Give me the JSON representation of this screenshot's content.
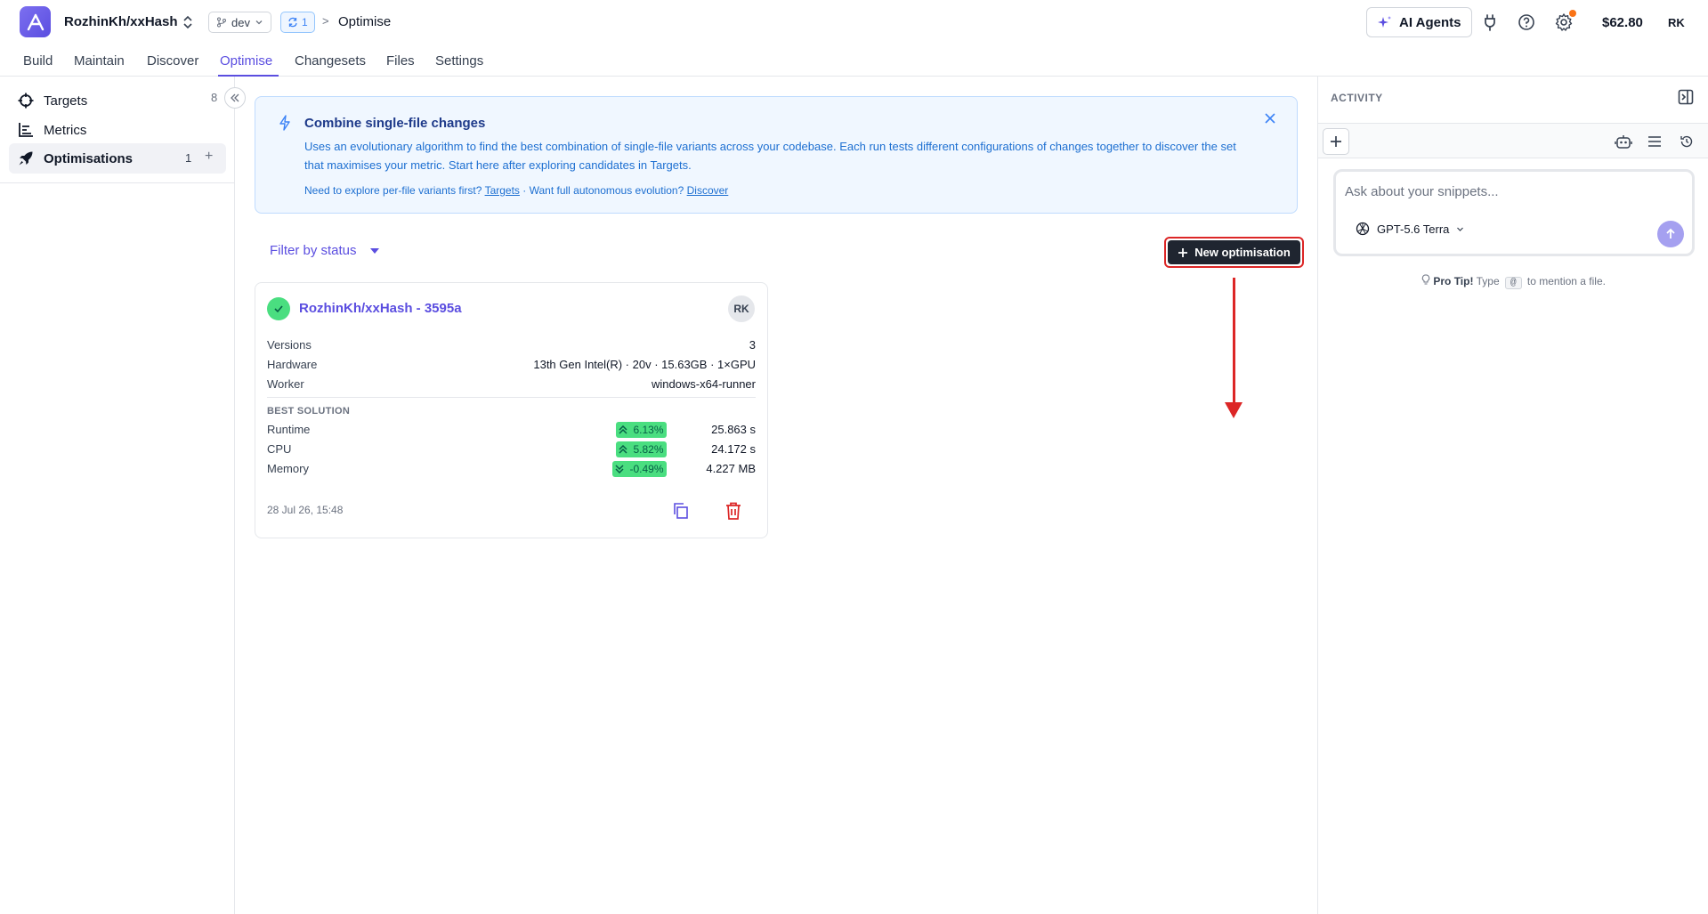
{
  "header": {
    "repo": "RozhinKh/xxHash",
    "branch": "dev",
    "sync_count": "1",
    "breadcrumb_sep": ">",
    "breadcrumb": "Optimise",
    "ai_agents_label": "AI Agents",
    "credits": "$62.80",
    "user_initials": "RK"
  },
  "tabs": [
    "Build",
    "Maintain",
    "Discover",
    "Optimise",
    "Changesets",
    "Files",
    "Settings"
  ],
  "sidebar": {
    "items": [
      {
        "label": "Targets",
        "count": "8",
        "icon": "crosshair-icon"
      },
      {
        "label": "Metrics",
        "count": "",
        "icon": "bar-chart-icon"
      },
      {
        "label": "Optimisations",
        "count": "1",
        "icon": "rocket-icon"
      }
    ]
  },
  "banner": {
    "title": "Combine single-file changes",
    "text": "Uses an evolutionary algorithm to find the best combination of single-file variants across your codebase. Each run tests different configurations of changes together to discover the set that maximises your metric. Start here after exploring candidates in Targets.",
    "links_prefix": "Need to explore per-file variants first?",
    "link_targets": "Targets",
    "links_middle": "· Want full autonomous evolution?",
    "link_discover": "Discover"
  },
  "filter_label": "Filter by status",
  "new_optimisation_label": "New optimisation",
  "card": {
    "title": "RozhinKh/xxHash - 3595a",
    "avatar": "RK",
    "details": [
      {
        "label": "Versions",
        "value": "3"
      },
      {
        "label": "Hardware",
        "value": "13th Gen Intel(R) · 20v · 15.63GB · 1×GPU"
      },
      {
        "label": "Worker",
        "value": "windows-x64-runner"
      }
    ],
    "best_solution_label": "BEST SOLUTION",
    "metrics": [
      {
        "label": "Runtime",
        "delta": "6.13%",
        "direction": "up",
        "value": "25.863 s"
      },
      {
        "label": "CPU",
        "delta": "5.82%",
        "direction": "up",
        "value": "24.172 s"
      },
      {
        "label": "Memory",
        "delta": "-0.49%",
        "direction": "down",
        "value": "4.227 MB"
      }
    ],
    "date": "28 Jul 26, 15:48"
  },
  "activity": {
    "title": "ACTIVITY",
    "chat_placeholder": "Ask about your snippets...",
    "model": "GPT-5.6 Terra",
    "pro_tip_bold": "Pro Tip!",
    "pro_tip_pre": "Type",
    "pro_tip_key": "@",
    "pro_tip_post": "to mention a file."
  },
  "colors": {
    "accent": "#5b4ee0",
    "success": "#4ade80",
    "danger": "#dc2626",
    "info_bg": "#f0f7ff"
  }
}
